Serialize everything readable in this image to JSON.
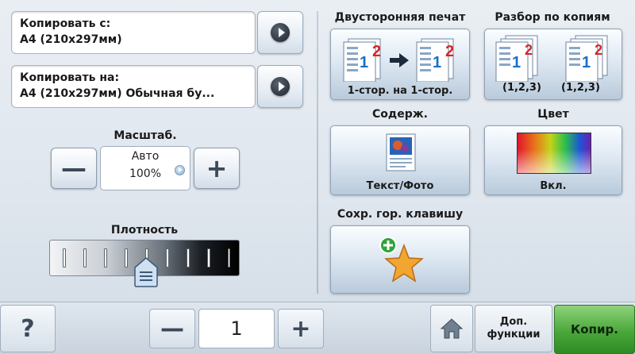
{
  "copy_from": {
    "label": "Копировать с:",
    "value": "A4 (210x297мм)"
  },
  "copy_to": {
    "label": "Копировать на:",
    "value": "A4 (210x297мм) Обычная бу..."
  },
  "scale": {
    "title": "Масштаб.",
    "mode": "Авто",
    "value": "100%",
    "minus": "—",
    "plus": "+"
  },
  "density": {
    "title": "Плотность",
    "level_fraction": 0.5
  },
  "duplex": {
    "title": "Двусторонняя печат",
    "caption": "1-стор. на 1-стор."
  },
  "collate": {
    "title": "Разбор по копиям",
    "caption_left": "(1,2,3)",
    "caption_right": "(1,2,3)"
  },
  "content": {
    "title": "Содерж.",
    "caption": "Текст/Фото"
  },
  "color": {
    "title": "Цвет",
    "caption": "Вкл."
  },
  "shortcut": {
    "title": "Сохр. гор. клавишу"
  },
  "footer": {
    "help": "?",
    "minus": "—",
    "copies": "1",
    "plus": "+",
    "extra_line1": "Доп.",
    "extra_line2": "функции",
    "copy": "Копир."
  },
  "colors": {
    "copy_button": "#4aa83a",
    "accent_blue": "#1b6fc7",
    "number_red": "#d6262b"
  }
}
